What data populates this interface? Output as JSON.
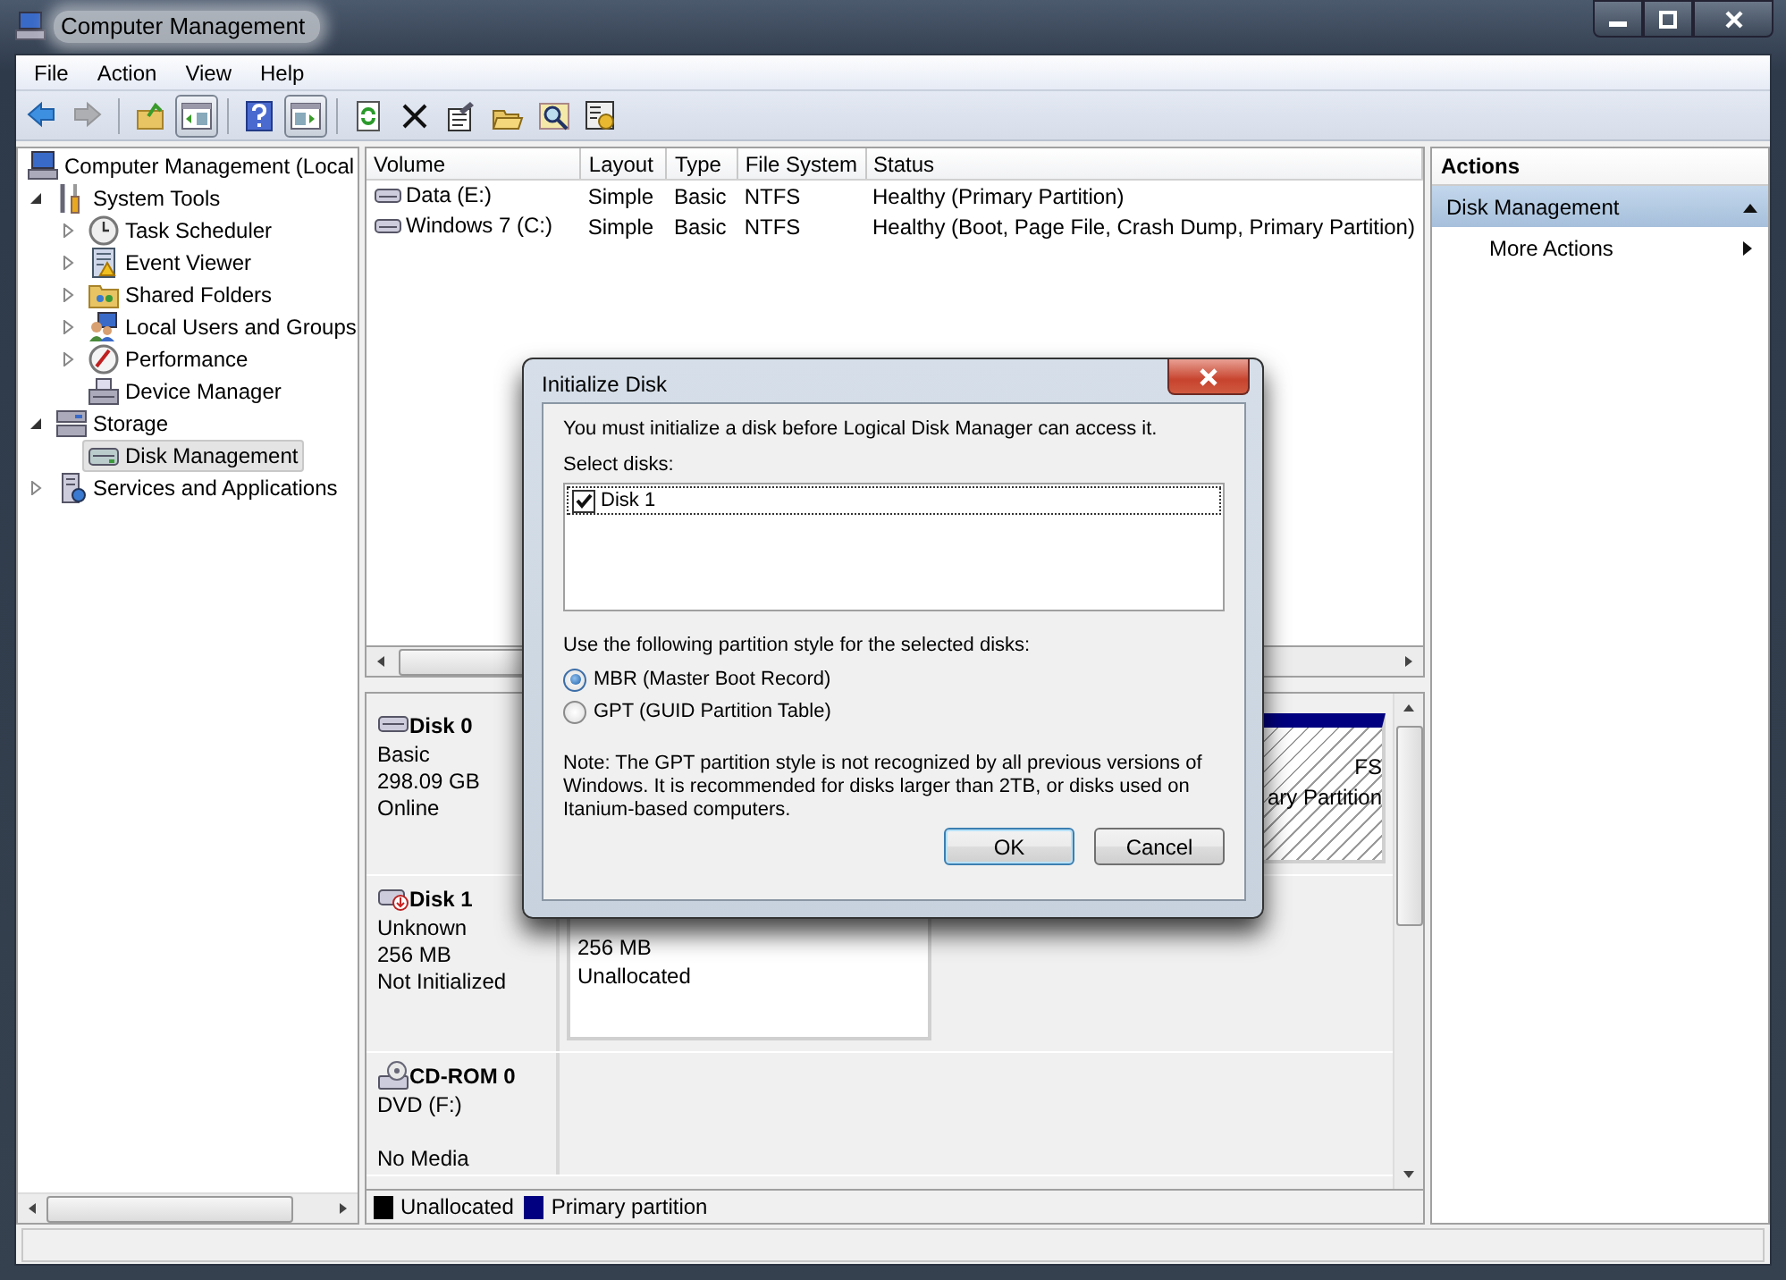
{
  "window": {
    "title": "Computer Management"
  },
  "menu": [
    "File",
    "Action",
    "View",
    "Help"
  ],
  "toolbar": [
    {
      "disabled": false,
      "pressed": false
    },
    {
      "disabled": true,
      "pressed": false
    },
    {
      "disabled": false,
      "pressed": false
    },
    {
      "disabled": false,
      "pressed": true
    },
    {
      "disabled": false,
      "pressed": false
    },
    {
      "disabled": false,
      "pressed": true
    },
    {
      "disabled": false,
      "pressed": false
    },
    {
      "disabled": false,
      "pressed": false
    },
    {
      "disabled": false,
      "pressed": false
    },
    {
      "disabled": false,
      "pressed": false
    },
    {
      "disabled": false,
      "pressed": false
    },
    {
      "disabled": false,
      "pressed": false
    }
  ],
  "tree": [
    {
      "label": "Computer Management (Local",
      "selected": false,
      "children": [
        {
          "label": "System Tools",
          "expanded": true,
          "selected": false,
          "children": [
            {
              "label": "Task Scheduler",
              "expanded": false,
              "selected": false
            },
            {
              "label": "Event Viewer",
              "expanded": false,
              "selected": false
            },
            {
              "label": "Shared Folders",
              "expanded": false,
              "selected": false
            },
            {
              "label": "Local Users and Groups",
              "expanded": false,
              "selected": false
            },
            {
              "label": "Performance",
              "expanded": false,
              "selected": false
            },
            {
              "label": "Device Manager",
              "selected": false
            }
          ]
        },
        {
          "label": "Storage",
          "expanded": true,
          "selected": false,
          "children": [
            {
              "label": "Disk Management",
              "selected": true
            }
          ]
        },
        {
          "label": "Services and Applications",
          "expanded": false,
          "selected": false
        }
      ]
    }
  ],
  "volumes": {
    "columns": [
      "Volume",
      "Layout",
      "Type",
      "File System",
      "Status"
    ],
    "rows": [
      [
        "Data (E:)",
        "Simple",
        "Basic",
        "NTFS",
        "Healthy (Primary Partition)"
      ],
      [
        "Windows 7 (C:)",
        "Simple",
        "Basic",
        "NTFS",
        "Healthy (Boot, Page File, Crash Dump, Primary Partition)"
      ]
    ]
  },
  "disks": [
    {
      "kind": "hdd",
      "name": "Disk 0",
      "details": [
        "Basic",
        "298.09 GB",
        "Online"
      ],
      "partitions": [
        {
          "kind": "primary",
          "lines": [
            "FS",
            "ary Partition"
          ]
        }
      ]
    },
    {
      "kind": "unknown",
      "name": "Disk 1",
      "details": [
        "Unknown",
        "256 MB",
        "Not Initialized"
      ],
      "partitions": [
        {
          "kind": "unallocated",
          "lines": [
            "256 MB",
            "Unallocated"
          ]
        }
      ]
    },
    {
      "kind": "cdrom",
      "name": "CD-ROM 0",
      "details": [
        "DVD (F:)",
        "No Media"
      ]
    }
  ],
  "legend": [
    {
      "label": "Unallocated",
      "color": "#000000"
    },
    {
      "label": "Primary partition",
      "color": "#000080"
    }
  ],
  "actions": {
    "title": "Actions",
    "items": [
      {
        "kind": "section",
        "label": "Disk Management",
        "expanded": true
      },
      {
        "kind": "link",
        "label": "More Actions"
      }
    ]
  },
  "dialog": {
    "title": "Initialize Disk",
    "message": "You must initialize a disk before Logical Disk Manager can access it.",
    "list_label": "Select disks:",
    "disks": [
      {
        "label": "Disk 1",
        "checked": true
      }
    ],
    "style_label": "Use the following partition style for the selected disks:",
    "options": [
      {
        "label": "MBR (Master Boot Record)",
        "selected": true
      },
      {
        "label": "GPT (GUID Partition Table)",
        "selected": false
      }
    ],
    "note": "Note: The GPT partition style is not recognized by all previous versions of Windows. It is recommended for disks larger than 2TB, or disks used on Itanium-based computers.",
    "buttons": [
      {
        "label": "OK",
        "default": true
      },
      {
        "label": "Cancel",
        "default": false
      }
    ]
  }
}
